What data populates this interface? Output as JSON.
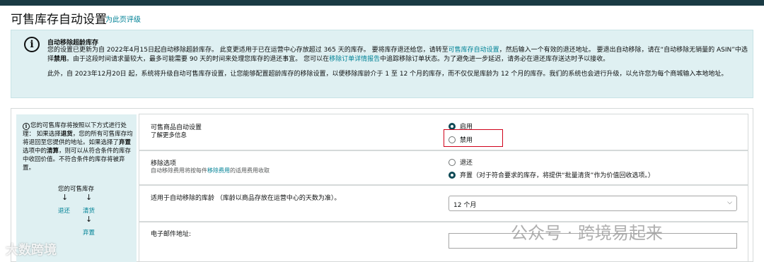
{
  "header": {
    "title": "可售库存自动设置",
    "rate_link": "为此页评级"
  },
  "alert": {
    "title": "自动移除超龄库存",
    "p1": {
      "a": "您的设置已更新为自 2022年4月15日起自动移除超龄库存。 此变更适用于已在运营中心存放超过 365 天的库存。 要将库存退还给您，请转至",
      "link1": "可售库存自动设置",
      "b": "，然后输入一个有效的退还地址。 要退出自动移除，请在“自动移除无销量的 ASIN”中选择",
      "bold": "禁用",
      "c": "。由于这段时间请求量较大，最多可能需要 90 天的时间来处理您库存的退还事宜。 您可以在",
      "link2": "移除订单详情报告",
      "d": "中追踪移除订单状态。为了避免进一步延迟，请务必在退还库存送达时予以接收。"
    },
    "p2": "此外，自 2023年12月20日 起，系统将升级自动可售库存设置，让您能够配置超龄库存的移除设置，以便移除库龄介于 1 至 12 个月的库存，而不仅仅是库龄为 12 个月的库存。我们的系统也会进行升级，以允许您为每个商城输入本地地址。"
  },
  "sidebar": {
    "t1": "您的可售库存将按照以下方式进行处理： 如果选择",
    "t1_bold": "退货",
    "t2": "，您的所有可售库存均将退回至您提供的地址。如果选择了",
    "t2_bold": "弃置",
    "t3": "选项中的",
    "t3_bold": "清算",
    "t4": "，则可以从符合条件的库存中收回价值。不符合条件的库存将被弃置。",
    "flow_top": "您的可售库存",
    "flow_arrow": "↓",
    "flow_return": "退还",
    "flow_liquidate": "清货",
    "flow_dispose": "弃置"
  },
  "auto_setting": {
    "label": "可售商品自动设置",
    "learn_more": "了解更多信息",
    "opt_enable": "启用",
    "opt_disable": "禁用"
  },
  "removal": {
    "label": "移除选项",
    "sub_prefix": "自动移除费用将按每件",
    "sub_link": "移除费用",
    "sub_suffix": "的适用费用收取",
    "opt_return": "退还",
    "opt_dispose": "弃置（对于符合要求的库存，将提供“批量清货”作为价值回收选项。）"
  },
  "age": {
    "label": "适用于自动移除的库龄 （库龄以商品存放在运营中心的天数为准）。",
    "selected": "12 个月"
  },
  "email": {
    "label": "电子邮件地址:",
    "value": ""
  },
  "watermarks": {
    "left": "大数跨境",
    "right": "公众号 · 跨境易起来"
  },
  "colors": {
    "accent_link": "#008296",
    "alert_bg": "#dff0f2",
    "radio_selected": "#0f4a56",
    "highlight": "#d0021b",
    "topbar": "#1a3b44"
  },
  "icons": {
    "alert": "info-circle-icon",
    "select": "chevron-down-icon",
    "radio_on": "radio-checked-icon",
    "radio_off": "radio-unchecked-icon"
  }
}
